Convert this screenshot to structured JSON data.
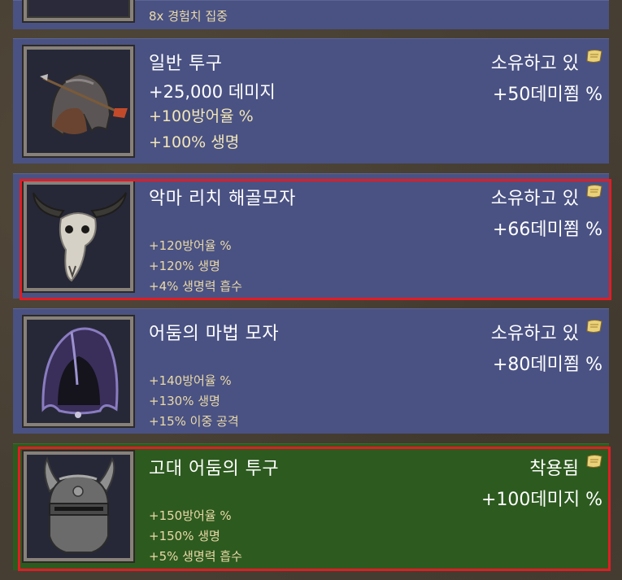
{
  "top_item": {
    "stat": "8x 경험치 집중"
  },
  "items": [
    {
      "name": "일반 투구",
      "status": "소유하고 있",
      "damage_bonus": "+50데미쬠 %",
      "stats": [
        "+25,000 데미지",
        "+100방어율 %",
        "+100% 생명"
      ]
    },
    {
      "name": "악마 리치 해골모자",
      "status": "소유하고 있",
      "damage_bonus": "+66데미쬠 %",
      "stats": [
        "+120방어율 %",
        "+120% 생명",
        "+4% 생명력 흡수"
      ]
    },
    {
      "name": "어둠의 마법 모자",
      "status": "소유하고 있",
      "damage_bonus": "+80데미쬠 %",
      "stats": [
        "+140방어율 %",
        "+130% 생명",
        "+15% 이중 공격"
      ]
    },
    {
      "name": "고대 어둠의 투구",
      "status": "착용됨",
      "damage_bonus": "+100데미지 %",
      "stats": [
        "+150방어율 %",
        "+150% 생명",
        "+5% 생명력 흡수"
      ]
    }
  ],
  "icons": [
    "helmet-with-arrow-icon",
    "bull-skull-icon",
    "purple-hood-icon",
    "horned-helmet-icon",
    "scroll-icon"
  ],
  "colors": {
    "panel": "#4a5283",
    "equipped_panel": "#2d5a1f",
    "selection_border": "#e01d25",
    "stat_text": "#ead9a8"
  }
}
